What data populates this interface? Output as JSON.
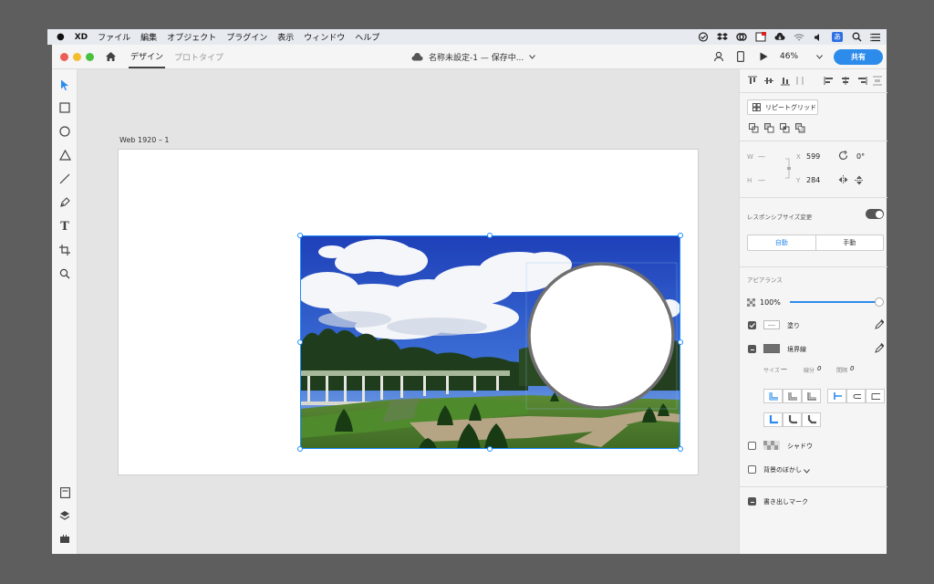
{
  "menubar": {
    "apple": "",
    "items": [
      "XD",
      "ファイル",
      "編集",
      "オブジェクト",
      "プラグイン",
      "表示",
      "ウィンドウ",
      "ヘルプ"
    ],
    "input_method": "あ"
  },
  "titlebar": {
    "tabs": [
      "デザイン",
      "プロトタイプ"
    ],
    "doc_title": "名称未設定-1 — 保存中...",
    "zoom": "46%",
    "share_label": "共有",
    "accent": "#2d8ceb"
  },
  "canvas": {
    "artboard_name": "Web 1920 – 1"
  },
  "panel": {
    "repeat_grid": "リピートグリッド",
    "w_label": "W",
    "w_value": "—",
    "h_label": "H",
    "h_value": "—",
    "x_label": "X",
    "x_value": "599",
    "y_label": "Y",
    "y_value": "284",
    "rotation": "0°",
    "responsive": "レスポンシブサイズ変更",
    "auto": "自動",
    "manual": "手動",
    "appearance": "アピアランス",
    "opacity": "100%",
    "opacity_level": 1.0,
    "fill": "塗り",
    "stroke": "境界線",
    "size_label": "サイズ",
    "size_value": "—",
    "dash_label": "線分",
    "dash_value": "0",
    "gap_label": "間隔",
    "gap_value": "0",
    "shadow": "シャドウ",
    "bg_blur": "背景のぼかし",
    "export_mark": "書き出しマーク"
  }
}
